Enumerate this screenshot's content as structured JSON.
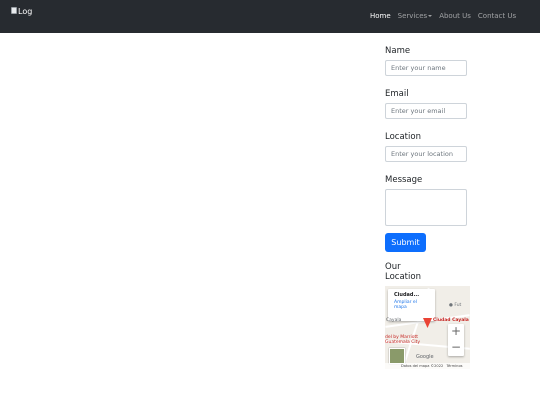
{
  "navbar": {
    "logo_alt": "Log",
    "links": [
      {
        "label": "Home",
        "active": true
      },
      {
        "label": "Services",
        "dropdown": true
      },
      {
        "label": "About Us"
      },
      {
        "label": "Contact Us"
      }
    ]
  },
  "form": {
    "name_label": "Name",
    "name_placeholder": "Enter your name",
    "email_label": "Email",
    "email_placeholder": "Enter your email",
    "location_label": "Location",
    "location_placeholder": "Enter your location",
    "message_label": "Message",
    "submit_label": "Submit"
  },
  "location": {
    "heading": "Our Location"
  },
  "map": {
    "card_title": "Ciudad...",
    "card_link": "Ampliar el mapa",
    "poi_place": "Ciudad Cayala",
    "poi_fut": "Fut",
    "poi_hotel": "del by Marriott Guatemala City",
    "area_label": "Cayala",
    "zoom_in": "+",
    "zoom_out": "−",
    "google": "Google",
    "attribution_left": "Datos del mapa ©2022",
    "attribution_right": "Términos"
  },
  "colors": {
    "navbar_bg": "#272b30",
    "primary": "#0d6efd",
    "pin": "#ea4335"
  }
}
